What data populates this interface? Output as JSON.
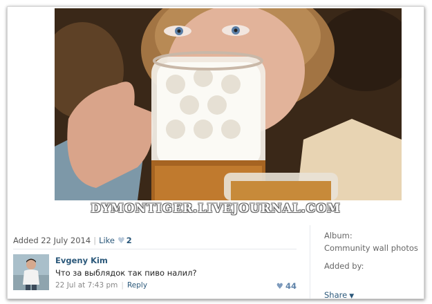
{
  "photo": {
    "caption": "DYMONTIGER.LIVEJOURNAL.COM"
  },
  "post_meta": {
    "added_label": "Added 22 July 2014",
    "like_label": "Like",
    "like_count": "2"
  },
  "comment": {
    "author": "Evgeny Kim",
    "text": "Что за выблядок так пиво налил?",
    "timestamp": "22 Jul at 7:43 pm",
    "reply_label": "Reply",
    "likes": "44"
  },
  "sidebar": {
    "album_label": "Album:",
    "album_value": "Community wall photos",
    "added_by_label": "Added by:",
    "share_label": "Share"
  },
  "colors": {
    "link": "#2b587a",
    "heart": "#7e9bbd"
  }
}
